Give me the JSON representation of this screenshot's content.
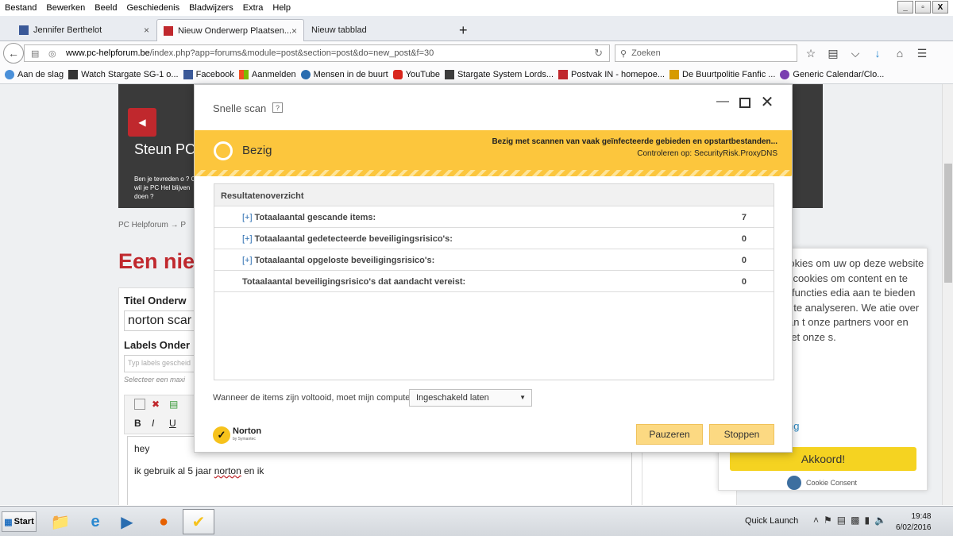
{
  "menubar": {
    "items": [
      "Bestand",
      "Bewerken",
      "Beeld",
      "Geschiedenis",
      "Bladwijzers",
      "Extra",
      "Help"
    ],
    "window_buttons": [
      "_",
      "▫",
      "X"
    ]
  },
  "tabs": [
    {
      "label": "Jennifer Berthelot",
      "close": "×"
    },
    {
      "label": "Nieuw Onderwerp Plaatsen...",
      "close": "×"
    },
    {
      "label": "Nieuw tabblad",
      "close": ""
    }
  ],
  "newtab_label": "+",
  "nav": {
    "url_host": "www.pc-helpforum.be",
    "url_path": "/index.php?app=forums&module=post&section=post&do=new_post&f=30",
    "search_placeholder": "Zoeken"
  },
  "bookmarks": [
    {
      "label": "Aan de slag",
      "color": "#4a90d9"
    },
    {
      "label": "Watch Stargate SG-1 o...",
      "color": "#333333"
    },
    {
      "label": "Facebook",
      "color": "#3b5998"
    },
    {
      "label": "Aanmelden",
      "color": "#e05a1a"
    },
    {
      "label": "Mensen in de buurt",
      "color": "#2a6db0"
    },
    {
      "label": "YouTube",
      "color": "#d9251c"
    },
    {
      "label": "Stargate System Lords...",
      "color": "#3c3c3c"
    },
    {
      "label": "Postvak IN - homepoe...",
      "color": "#c0282d"
    },
    {
      "label": "De Buurtpolitie Fanfic ...",
      "color": "#d69b00"
    },
    {
      "label": "Generic Calendar/Clo...",
      "color": "#7a3fb0"
    }
  ],
  "page": {
    "banner_title": "Steun PC",
    "banner_text": "Ben je tevreden o ? Of wil je PC Hel blijven doen ?",
    "breadcrumb": "PC Helpforum  →  P",
    "big_title": "Een nie",
    "title_label": "Titel Onderw",
    "title_value": "norton scar",
    "labels_label": "Labels Onder",
    "labels_placeholder": "Typ labels gescheid",
    "labels_hint": "Selecteer een maxi",
    "editor_line1": "hey",
    "editor_line2_pre": "ik gebruik al 5 jaar ",
    "editor_line2_word": "norton",
    "editor_line2_post": " en ik"
  },
  "cookie": {
    "text": "n gebruikt cookies om uw op deze website r te maken. n cookies om content en te plaatsen, om functies edia aan te bieden en om erkeer te analyseren. We atie over uw gebruik van t onze partners voor en analyse en met onze s.",
    "link": "ookieverklaring",
    "ok": "Akkoord!",
    "brand": "Cookie Consent"
  },
  "dialog": {
    "title": "Snelle scan",
    "help": "?",
    "state": "Bezig",
    "message_1": "Bezig met scannen van vaak geïnfecteerde gebieden en opstartbestanden...",
    "message_2": "Controleren op: SecurityRisk.ProxyDNS",
    "results_header": "Resultatenoverzicht",
    "rows": [
      {
        "expand": "[+]",
        "label": "Totaalaantal gescande items:",
        "value": "7"
      },
      {
        "expand": "[+]",
        "label": "Totaalaantal gedetecteerde beveiligingsrisico's:",
        "value": "0"
      },
      {
        "expand": "[+]",
        "label": "Totaalaantal opgeloste beveiligingsrisico's:",
        "value": "0"
      },
      {
        "expand": "",
        "label": "Totaalaantal beveiligingsrisico's dat aandacht vereist:",
        "value": "0"
      }
    ],
    "when_label": "Wanneer de items zijn voltooid, moet mijn computer",
    "when_value": "Ingeschakeld laten",
    "logo_name": "Norton",
    "logo_sub": "by Symantec",
    "pause": "Pauzeren",
    "stop": "Stoppen",
    "accent_color": "#fcc63d"
  },
  "taskbar": {
    "start": "Start",
    "quick_launch": "Quick Launch",
    "time": "19:48",
    "date": "6/02/2016"
  }
}
